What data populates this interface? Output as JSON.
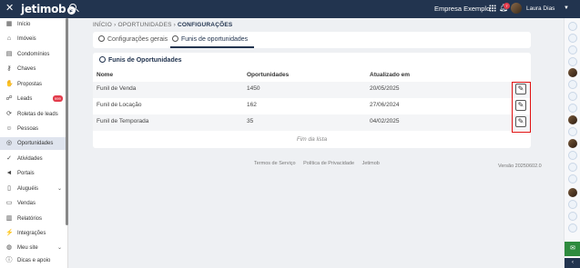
{
  "topbar": {
    "close_icon": "close-icon",
    "logo": "jetimob",
    "company": "Empresa Exemplo",
    "notification_count": "7",
    "user_name": "Laura Dias"
  },
  "sidebar": {
    "items": [
      {
        "label": "Início",
        "icon": "grid-icon"
      },
      {
        "label": "Imóveis",
        "icon": "house-icon"
      },
      {
        "label": "Condomínios",
        "icon": "building-icon"
      },
      {
        "label": "Chaves",
        "icon": "key-icon"
      },
      {
        "label": "Propostas",
        "icon": "handshake-icon"
      },
      {
        "label": "Leads",
        "icon": "users-icon",
        "badge": "999"
      },
      {
        "label": "Roletas de leads",
        "icon": "roulette-icon"
      },
      {
        "label": "Pessoas",
        "icon": "people-icon"
      },
      {
        "label": "Oportunidades",
        "icon": "target-icon"
      },
      {
        "label": "Atividades",
        "icon": "check-circle-icon"
      },
      {
        "label": "Portais",
        "icon": "megaphone-icon"
      },
      {
        "label": "Aluguéis",
        "icon": "rent-icon"
      },
      {
        "label": "Vendas",
        "icon": "sale-icon"
      },
      {
        "label": "Relatórios",
        "icon": "report-icon"
      },
      {
        "label": "Integrações",
        "icon": "plug-icon"
      },
      {
        "label": "Meu site",
        "icon": "globe-icon"
      },
      {
        "label": "Dicas e apoio",
        "icon": "info-icon"
      }
    ]
  },
  "breadcrumb": {
    "inicio": "INÍCIO",
    "oportunidades": "OPORTUNIDADES",
    "current": "CONFIGURAÇÕES"
  },
  "tabs": {
    "general": "Configurações gerais",
    "funnels": "Funis de oportunidades"
  },
  "card": {
    "title": "Funis de Oportunidades",
    "headers": {
      "name": "Nome",
      "opportunities": "Oportunidades",
      "updated": "Atualizado em"
    },
    "rows": [
      {
        "name": "Funil de Venda",
        "opportunities": "1450",
        "updated": "20/05/2025"
      },
      {
        "name": "Funil de Locação",
        "opportunities": "162",
        "updated": "27/06/2024"
      },
      {
        "name": "Funil de Temporada",
        "opportunities": "35",
        "updated": "04/02/2025"
      }
    ],
    "end_of_list": "Fim da lista"
  },
  "footer": {
    "terms": "Termos de Serviço",
    "privacy": "Política de Privacidade",
    "brand": "Jetimob",
    "version": "Versão 20250602.0"
  },
  "colors": {
    "topbar": "#22344f",
    "accent": "#22344f",
    "badge": "#e23b4b",
    "highlight": "#e01010",
    "chat": "#2e8b3e"
  }
}
